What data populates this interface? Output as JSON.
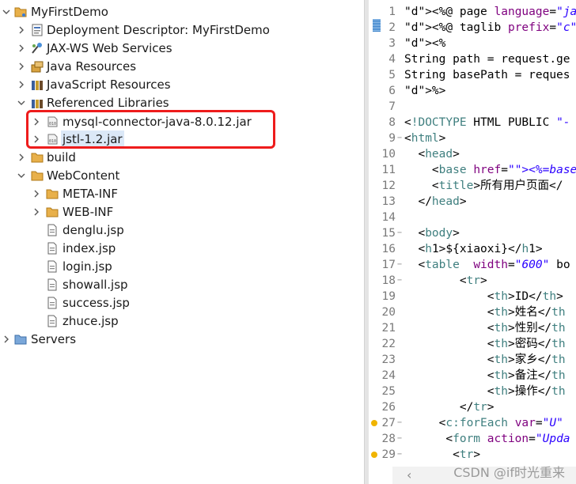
{
  "tree": {
    "project": "MyFirstDemo",
    "items": [
      {
        "label": "Deployment Descriptor: MyFirstDemo",
        "icon": "deployment-descriptor-icon"
      },
      {
        "label": "JAX-WS Web Services",
        "icon": "web-services-icon"
      },
      {
        "label": "Java Resources",
        "icon": "java-resources-icon"
      },
      {
        "label": "JavaScript Resources",
        "icon": "javascript-resources-icon"
      },
      {
        "label": "Referenced Libraries",
        "icon": "library-icon"
      },
      {
        "label": "mysql-connector-java-8.0.12.jar",
        "icon": "jar-icon"
      },
      {
        "label": "jstl-1.2.jar",
        "icon": "jar-icon"
      },
      {
        "label": "build",
        "icon": "folder-icon"
      },
      {
        "label": "WebContent",
        "icon": "folder-icon"
      },
      {
        "label": "META-INF",
        "icon": "folder-icon"
      },
      {
        "label": "WEB-INF",
        "icon": "folder-icon"
      },
      {
        "label": "denglu.jsp",
        "icon": "jsp-file-icon"
      },
      {
        "label": "index.jsp",
        "icon": "jsp-file-icon"
      },
      {
        "label": "login.jsp",
        "icon": "jsp-file-icon"
      },
      {
        "label": "showall.jsp",
        "icon": "jsp-file-icon"
      },
      {
        "label": "success.jsp",
        "icon": "jsp-file-icon"
      },
      {
        "label": "zhuce.jsp",
        "icon": "jsp-file-icon"
      }
    ],
    "servers": "Servers",
    "selected": "jstl-1.2.jar",
    "highlight_color": "#ee1c1c"
  },
  "editor": {
    "line_numbers": [
      "1",
      "2",
      "3",
      "4",
      "5",
      "6",
      "7",
      "8",
      "9",
      "10",
      "11",
      "12",
      "13",
      "14",
      "15",
      "16",
      "17",
      "18",
      "19",
      "20",
      "21",
      "22",
      "23",
      "24",
      "25",
      "26",
      "27",
      "28",
      "29"
    ],
    "lines": [
      "<%@ page language=\"java\"",
      "<%@ taglib prefix=\"c\" ur",
      "<%",
      "String path = request.ge",
      "String basePath = reques",
      "%>",
      "",
      "<!DOCTYPE HTML PUBLIC \"-",
      "<html>",
      "  <head>",
      "    <base href=\"<%=baseP",
      "    <title>所有用户页面</",
      "  </head>",
      "",
      "  <body>",
      "  <h1>${xiaoxi}</h1>",
      "  <table  width=\"600\" bo",
      "        <tr>",
      "            <th>ID</th>",
      "            <th>姓名</th",
      "            <th>性别</th",
      "            <th>密码</th",
      "            <th>家乡</th",
      "            <th>备注</th",
      "            <th>操作</th",
      "        </tr>",
      "     <c:forEach var=\"U\"",
      "      <form action=\"Upda",
      "       <tr>"
    ]
  },
  "watermark": "CSDN @if时光重来"
}
